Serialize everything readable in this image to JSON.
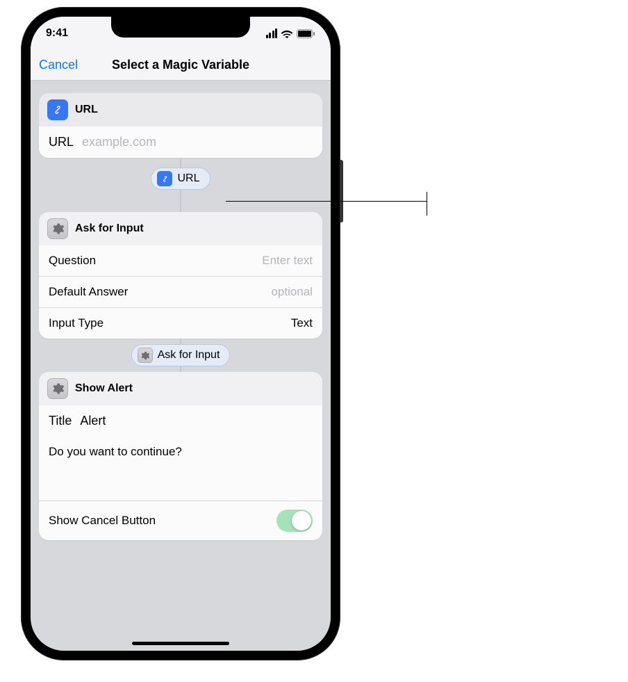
{
  "status_bar": {
    "time": "9:41"
  },
  "nav": {
    "cancel": "Cancel",
    "title": "Select a Magic Variable"
  },
  "url_card": {
    "title": "URL",
    "field_label": "URL",
    "field_placeholder": "example.com"
  },
  "pill_url": "URL",
  "ask_card": {
    "title": "Ask for Input",
    "question_label": "Question",
    "question_placeholder": "Enter text",
    "default_label": "Default Answer",
    "default_placeholder": "optional",
    "inputtype_label": "Input Type",
    "inputtype_value": "Text"
  },
  "pill_ask": "Ask for Input",
  "alert_card": {
    "title": "Show Alert",
    "title_label": "Title",
    "title_value": "Alert",
    "body": "Do you want to continue?",
    "cancel_toggle_label": "Show Cancel Button",
    "cancel_toggle_on": true
  }
}
